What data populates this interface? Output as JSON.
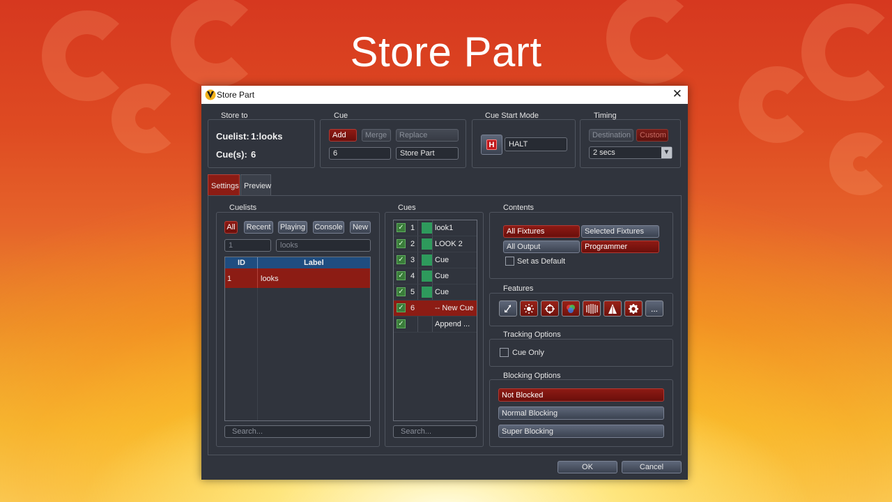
{
  "slide_title": "Store Part",
  "window": {
    "title": "Store Part"
  },
  "store_to": {
    "heading": "Store to",
    "cuelist_label": "Cuelist:",
    "cuelist_value": "1:looks",
    "cues_label": "Cue(s):",
    "cues_value": "6"
  },
  "cue": {
    "heading": "Cue",
    "add": "Add",
    "merge": "Merge",
    "replace": "Replace",
    "number": "6",
    "name": "Store Part"
  },
  "cue_start_mode": {
    "heading": "Cue Start Mode",
    "badge": "H",
    "value": "HALT"
  },
  "timing": {
    "heading": "Timing",
    "destination": "Destination",
    "custom": "Custom",
    "value": "2 secs"
  },
  "tabs": [
    "Settings",
    "Preview"
  ],
  "cuelists": {
    "heading": "Cuelists",
    "filters": [
      "All",
      "Recent",
      "Playing",
      "Console",
      "New"
    ],
    "new_id": "1",
    "new_label": "looks",
    "columns": [
      "ID",
      "Label"
    ],
    "rows": [
      {
        "id": "1",
        "label": "looks"
      }
    ],
    "search_placeholder": "Search..."
  },
  "cues": {
    "heading": "Cues",
    "rows": [
      {
        "num": "1",
        "label": "look1"
      },
      {
        "num": "2",
        "label": "LOOK 2"
      },
      {
        "num": "3",
        "label": "Cue"
      },
      {
        "num": "4",
        "label": "Cue"
      },
      {
        "num": "5",
        "label": "Cue"
      },
      {
        "num": "6",
        "label": "-- New Cue"
      },
      {
        "num": "",
        "label": "Append ..."
      }
    ],
    "search_placeholder": "Search..."
  },
  "contents": {
    "heading": "Contents",
    "all_fixtures": "All Fixtures",
    "selected_fixtures": "Selected Fixtures",
    "all_output": "All Output",
    "programmer": "Programmer",
    "set_default": "Set as Default"
  },
  "features": {
    "heading": "Features",
    "icons": [
      "position-icon",
      "intensity-icon",
      "focus-icon",
      "color-icon",
      "beam-icon",
      "shape-icon",
      "control-icon"
    ],
    "more": "..."
  },
  "tracking": {
    "heading": "Tracking Options",
    "cue_only": "Cue Only"
  },
  "blocking": {
    "heading": "Blocking Options",
    "not_blocked": "Not Blocked",
    "normal_blocking": "Normal Blocking",
    "super_blocking": "Super Blocking"
  },
  "buttons": {
    "ok": "OK",
    "cancel": "Cancel"
  },
  "colors": {
    "accent_red": "#8c1c14",
    "header_blue": "#1f4d80",
    "dialog_bg": "#30343d",
    "cue_green": "#2e9a5c"
  }
}
